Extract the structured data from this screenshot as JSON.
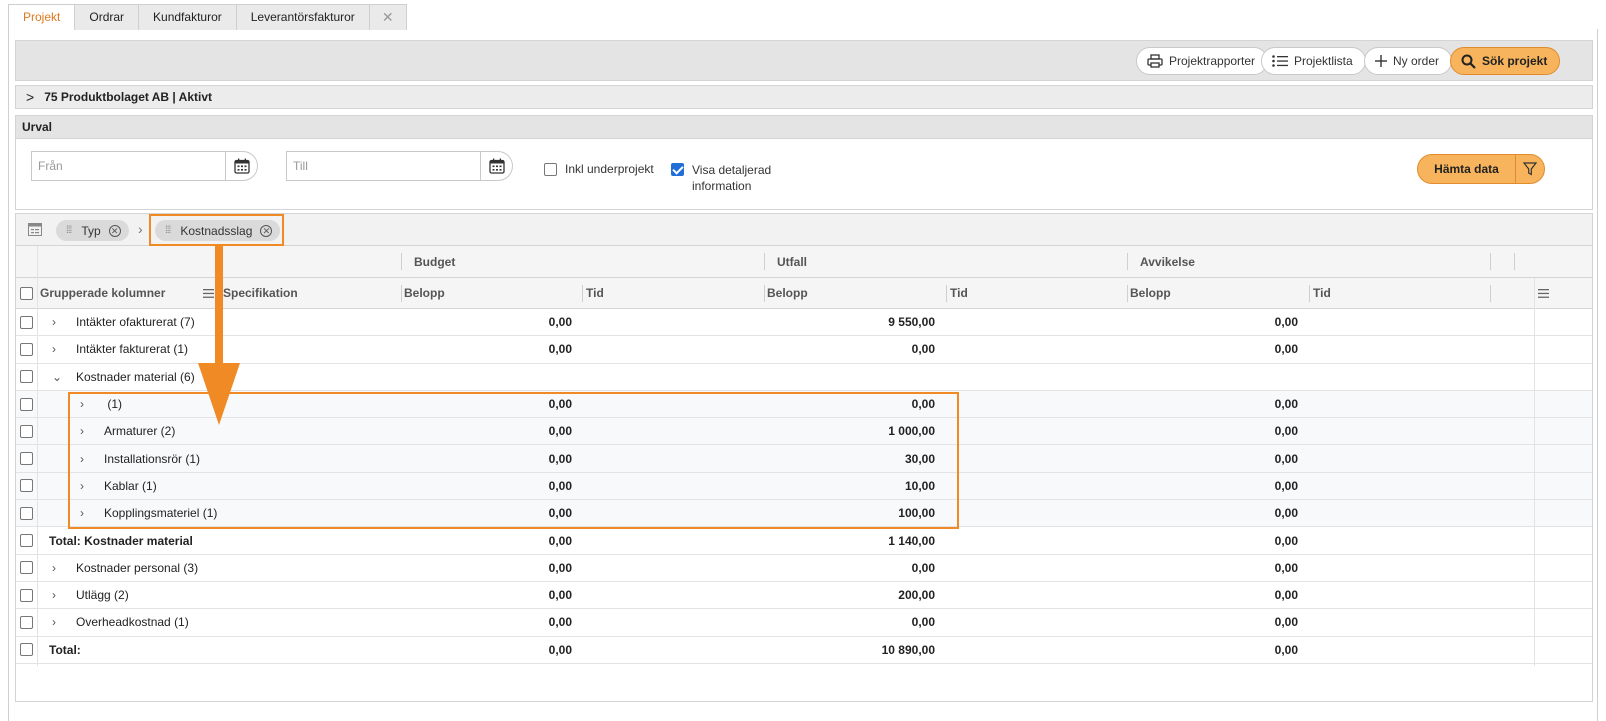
{
  "tabs": [
    {
      "label": "Projekt",
      "active": true
    },
    {
      "label": "Ordrar",
      "active": false
    },
    {
      "label": "Kundfakturor",
      "active": false
    },
    {
      "label": "Leverantörsfakturor",
      "active": false
    }
  ],
  "tab_close": "✕",
  "toolbar": {
    "reports_label": "Projektrapporter",
    "list_label": "Projektlista",
    "new_order_label": "Ny order",
    "search_label": "Sök projekt"
  },
  "project": {
    "title": "75 Produktbolaget AB | Aktivt"
  },
  "urval": {
    "title": "Urval",
    "from_placeholder": "Från",
    "to_placeholder": "Till",
    "inkl_label": "Inkl underprojekt",
    "inkl_checked": false,
    "visa_label_1": "Visa detaljerad",
    "visa_label_2": "information",
    "visa_checked": true,
    "fetch_label": "Hämta data"
  },
  "grouping": {
    "chips": [
      {
        "label": "Typ"
      },
      {
        "label": "Kostnadsslag"
      }
    ],
    "separator": "›"
  },
  "grid": {
    "group_headers": {
      "budget": "Budget",
      "utfall": "Utfall",
      "avvikelse": "Avvikelse"
    },
    "columns": {
      "grouped": "Grupperade kolumner",
      "spec": "Specifikation",
      "budget_belopp": "Belopp",
      "budget_tid": "Tid",
      "utfall_belopp": "Belopp",
      "utfall_tid": "Tid",
      "avv_belopp": "Belopp",
      "avv_tid": "Tid"
    },
    "rows": [
      {
        "label": "Intäkter ofakturerat (7)",
        "level": 0,
        "expander": "›",
        "budget": "0,00",
        "utfall": "9 550,00",
        "avvikelse": "0,00"
      },
      {
        "label": "Intäkter fakturerat (1)",
        "level": 0,
        "expander": "›",
        "budget": "0,00",
        "utfall": "0,00",
        "avvikelse": "0,00"
      },
      {
        "label": "Kostnader material (6)",
        "level": 0,
        "expander": "⌄",
        "budget": "",
        "utfall": "",
        "avvikelse": ""
      },
      {
        "label": " (1)",
        "level": 1,
        "expander": "›",
        "budget": "0,00",
        "utfall": "0,00",
        "avvikelse": "0,00"
      },
      {
        "label": "Armaturer (2)",
        "level": 1,
        "expander": "›",
        "budget": "0,00",
        "utfall": "1 000,00",
        "avvikelse": "0,00"
      },
      {
        "label": "Installationsrör (1)",
        "level": 1,
        "expander": "›",
        "budget": "0,00",
        "utfall": "30,00",
        "avvikelse": "0,00"
      },
      {
        "label": "Kablar (1)",
        "level": 1,
        "expander": "›",
        "budget": "0,00",
        "utfall": "10,00",
        "avvikelse": "0,00"
      },
      {
        "label": "Kopplingsmateriel (1)",
        "level": 1,
        "expander": "›",
        "budget": "0,00",
        "utfall": "100,00",
        "avvikelse": "0,00"
      },
      {
        "label": "Total: Kostnader material",
        "level": -1,
        "expander": "",
        "budget": "0,00",
        "utfall": "1 140,00",
        "avvikelse": "0,00"
      },
      {
        "label": "Kostnader personal (3)",
        "level": 0,
        "expander": "›",
        "budget": "0,00",
        "utfall": "0,00",
        "avvikelse": "0,00"
      },
      {
        "label": "Utlägg (2)",
        "level": 0,
        "expander": "›",
        "budget": "0,00",
        "utfall": "200,00",
        "avvikelse": "0,00"
      },
      {
        "label": "Overheadkostnad (1)",
        "level": 0,
        "expander": "›",
        "budget": "0,00",
        "utfall": "0,00",
        "avvikelse": "0,00"
      },
      {
        "label": "Total:",
        "level": -1,
        "expander": "",
        "budget": "0,00",
        "utfall": "10 890,00",
        "avvikelse": "0,00"
      }
    ]
  },
  "colors": {
    "accent": "#f08a24",
    "button_primary": "#f7b45c",
    "checkbox_checked": "#1f6fd6",
    "active_tab_text": "#e0781e"
  }
}
